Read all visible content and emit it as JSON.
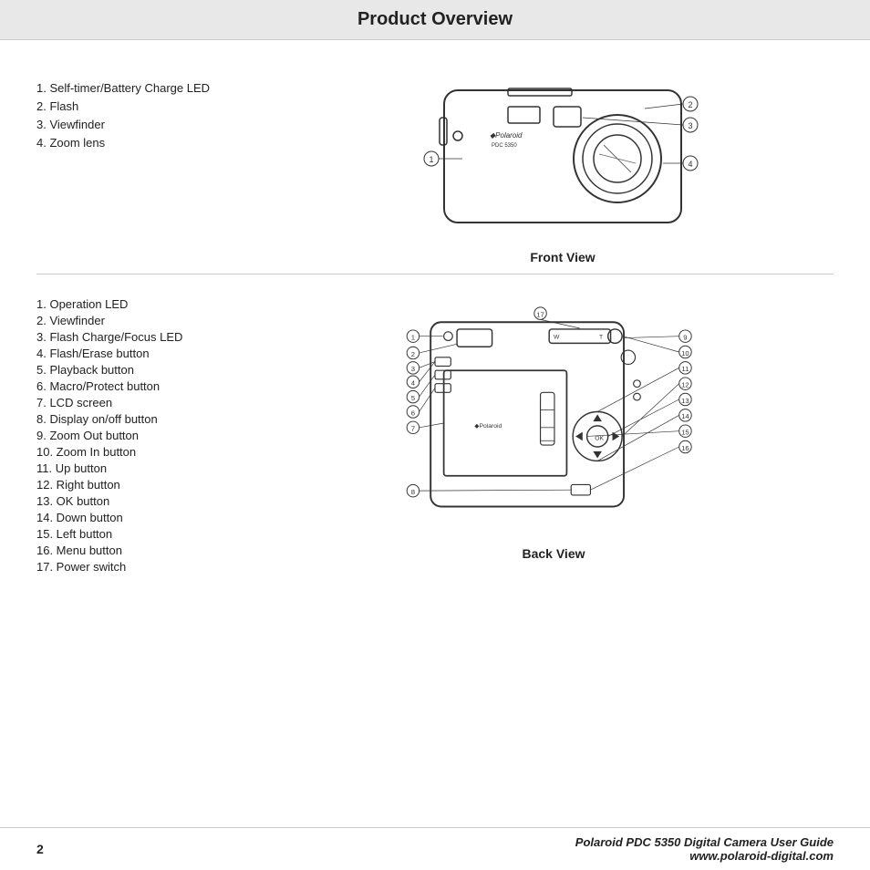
{
  "header": {
    "title": "Product Overview"
  },
  "front_section": {
    "items": [
      "1.  Self-timer/Battery Charge LED",
      "2.  Flash",
      "3.  Viewfinder",
      "4.  Zoom lens"
    ],
    "diagram_label": "Front View"
  },
  "back_section": {
    "items": [
      "1.   Operation LED",
      "2.   Viewfinder",
      "3.   Flash Charge/Focus LED",
      "4.   Flash/Erase button",
      "5.   Playback button",
      "6.   Macro/Protect button",
      "7.   LCD screen",
      "8.   Display on/off button",
      "9.   Zoom Out button",
      "10. Zoom In button",
      "11. Up button",
      "12. Right button",
      "13. OK button",
      "14. Down button",
      "15. Left button",
      "16. Menu button",
      "17. Power switch"
    ],
    "diagram_label": "Back View"
  },
  "footer": {
    "page_number": "2",
    "title_line1": "Polaroid PDC 5350 Digital Camera User Guide",
    "title_line2": "www.polaroid-digital.com"
  }
}
